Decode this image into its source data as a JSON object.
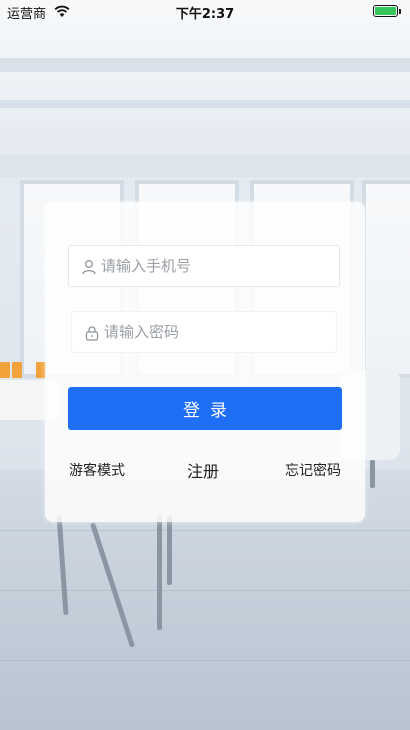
{
  "status_bar": {
    "carrier": "运营商",
    "time": "下午2:37",
    "battery_level": 1.0,
    "battery_color": "#35c759"
  },
  "login": {
    "phone_placeholder": "请输入手机号",
    "password_placeholder": "请输入密码",
    "login_label": "登录",
    "guest_mode": "游客模式",
    "register": "注册",
    "forgot_password": "忘记密码"
  },
  "colors": {
    "primary": "#1f6ef6",
    "card_bg": "rgba(255,255,255,0.82)"
  },
  "icons": {
    "phone_field": "user-icon",
    "password_field": "lock-icon",
    "wifi": "wifi-icon",
    "battery": "battery-icon"
  }
}
